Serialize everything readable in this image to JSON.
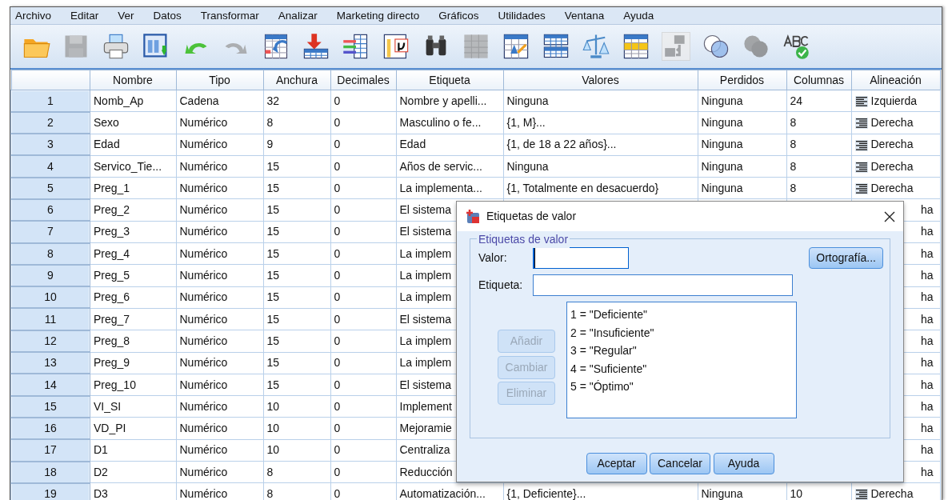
{
  "menu": [
    "Archivo",
    "Editar",
    "Ver",
    "Datos",
    "Transformar",
    "Analizar",
    "Marketing directo",
    "Gráficos",
    "Utilidades",
    "Ventana",
    "Ayuda"
  ],
  "toolbar": [
    {
      "kind": "open",
      "disabled": false
    },
    {
      "kind": "save",
      "disabled": true
    },
    {
      "kind": "print",
      "disabled": false
    },
    {
      "kind": "recall",
      "disabled": false
    },
    {
      "kind": "undo",
      "disabled": false
    },
    {
      "kind": "redo",
      "disabled": true
    },
    {
      "kind": "goto_case",
      "disabled": false
    },
    {
      "kind": "goto_var",
      "disabled": false
    },
    {
      "kind": "variables",
      "disabled": false
    },
    {
      "kind": "descriptives",
      "disabled": false
    },
    {
      "kind": "find",
      "disabled": false
    },
    {
      "kind": "insert_cases",
      "disabled": true
    },
    {
      "kind": "insert_var",
      "disabled": false
    },
    {
      "kind": "split",
      "disabled": false
    },
    {
      "kind": "weight",
      "disabled": false
    },
    {
      "kind": "select",
      "disabled": false
    },
    {
      "kind": "value_labels",
      "disabled": true
    },
    {
      "kind": "sets",
      "disabled": false
    },
    {
      "kind": "all_vars",
      "disabled": true
    },
    {
      "kind": "spell",
      "disabled": false
    }
  ],
  "table": {
    "columns": [
      "Nombre",
      "Tipo",
      "Anchura",
      "Decimales",
      "Etiqueta",
      "Valores",
      "Perdidos",
      "Columnas",
      "Alineación"
    ],
    "rows": [
      {
        "n": "1",
        "nombre": "Nomb_Ap",
        "tipo": "Cadena",
        "anchura": "32",
        "decimales": "0",
        "etiqueta": "Nombre y apelli...",
        "valores": "Ninguna",
        "perdidos": "Ninguna",
        "columnas": "24",
        "alineacion": {
          "text": "Izquierda",
          "kind": "align_left"
        }
      },
      {
        "n": "2",
        "nombre": "Sexo",
        "tipo": "Numérico",
        "anchura": "8",
        "decimales": "0",
        "etiqueta": "Masculino o fe...",
        "valores": "{1, M}...",
        "perdidos": "Ninguna",
        "columnas": "8",
        "alineacion": {
          "text": "Derecha",
          "kind": "align_right"
        }
      },
      {
        "n": "3",
        "nombre": "Edad",
        "tipo": "Numérico",
        "anchura": "9",
        "decimales": "0",
        "etiqueta": "Edad",
        "valores": "{1, de 18 a 22 años}...",
        "perdidos": "Ninguna",
        "columnas": "8",
        "alineacion": {
          "text": "Derecha",
          "kind": "align_right"
        }
      },
      {
        "n": "4",
        "nombre": "Servico_Tie...",
        "tipo": "Numérico",
        "anchura": "15",
        "decimales": "0",
        "etiqueta": "Años de servic...",
        "valores": "Ninguna",
        "perdidos": "Ninguna",
        "columnas": "8",
        "alineacion": {
          "text": "Derecha",
          "kind": "align_right"
        }
      },
      {
        "n": "5",
        "nombre": "Preg_1",
        "tipo": "Numérico",
        "anchura": "15",
        "decimales": "0",
        "etiqueta": "La implementa...",
        "valores": "{1, Totalmente en desacuerdo}",
        "perdidos": "Ninguna",
        "columnas": "8",
        "alineacion": {
          "text": "Derecha",
          "kind": "align_right"
        }
      },
      {
        "n": "6",
        "nombre": "Preg_2",
        "tipo": "Numérico",
        "anchura": "15",
        "decimales": "0",
        "etiqueta": "El sistema",
        "alineacion": {
          "text": "ha"
        }
      },
      {
        "n": "7",
        "nombre": "Preg_3",
        "tipo": "Numérico",
        "anchura": "15",
        "decimales": "0",
        "etiqueta": "El sistema",
        "alineacion": {
          "text": "ha"
        }
      },
      {
        "n": "8",
        "nombre": "Preg_4",
        "tipo": "Numérico",
        "anchura": "15",
        "decimales": "0",
        "etiqueta": "La implem",
        "alineacion": {
          "text": "ha"
        }
      },
      {
        "n": "9",
        "nombre": "Preg_5",
        "tipo": "Numérico",
        "anchura": "15",
        "decimales": "0",
        "etiqueta": "La implem",
        "alineacion": {
          "text": "ha"
        }
      },
      {
        "n": "10",
        "nombre": "Preg_6",
        "tipo": "Numérico",
        "anchura": "15",
        "decimales": "0",
        "etiqueta": "La implem",
        "alineacion": {
          "text": "ha"
        }
      },
      {
        "n": "11",
        "nombre": "Preg_7",
        "tipo": "Numérico",
        "anchura": "15",
        "decimales": "0",
        "etiqueta": "El sistema",
        "alineacion": {
          "text": "ha"
        }
      },
      {
        "n": "12",
        "nombre": "Preg_8",
        "tipo": "Numérico",
        "anchura": "15",
        "decimales": "0",
        "etiqueta": "La implem",
        "alineacion": {
          "text": "ha"
        }
      },
      {
        "n": "13",
        "nombre": "Preg_9",
        "tipo": "Numérico",
        "anchura": "15",
        "decimales": "0",
        "etiqueta": "La implem",
        "alineacion": {
          "text": "ha"
        }
      },
      {
        "n": "14",
        "nombre": "Preg_10",
        "tipo": "Numérico",
        "anchura": "15",
        "decimales": "0",
        "etiqueta": "El sistema",
        "alineacion": {
          "text": "ha"
        }
      },
      {
        "n": "15",
        "nombre": "VI_SI",
        "tipo": "Numérico",
        "anchura": "10",
        "decimales": "0",
        "etiqueta": "Implement",
        "alineacion": {
          "text": "ha"
        }
      },
      {
        "n": "16",
        "nombre": "VD_PI",
        "tipo": "Numérico",
        "anchura": "10",
        "decimales": "0",
        "etiqueta": "Mejoramie",
        "alineacion": {
          "text": "ha"
        }
      },
      {
        "n": "17",
        "nombre": "D1",
        "tipo": "Numérico",
        "anchura": "10",
        "decimales": "0",
        "etiqueta": "Centraliza",
        "alineacion": {
          "text": "ha"
        }
      },
      {
        "n": "18",
        "nombre": "D2",
        "tipo": "Numérico",
        "anchura": "8",
        "decimales": "0",
        "etiqueta": "Reducción",
        "alineacion": {
          "text": "ha"
        }
      },
      {
        "n": "19",
        "nombre": "D3",
        "tipo": "Numérico",
        "anchura": "8",
        "decimales": "0",
        "etiqueta": "Automatización...",
        "valores": "{1, Deficiente}...",
        "perdidos": "Ninguna",
        "columnas": "10",
        "alineacion": {
          "text": "Derecha",
          "kind": "align_right"
        }
      }
    ]
  },
  "dialog": {
    "title": "Etiquetas de valor",
    "group_title": "Etiquetas de valor",
    "valor": {
      "label": "Valor:",
      "focused": true
    },
    "etiqueta": {
      "label": "Etiqueta:"
    },
    "spell_button": "Ortografía...",
    "side_buttons": [
      {
        "label": "Añadir",
        "disabled": true
      },
      {
        "label": "Cambiar",
        "disabled": true
      },
      {
        "label": "Eliminar",
        "disabled": true
      }
    ],
    "labels": [
      {
        "text": "1 = \"Deficiente\"",
        "selected": false
      },
      {
        "text": "2 = \"Insuficiente\"",
        "selected": false
      },
      {
        "text": "3 = \"Regular\"",
        "selected": false
      },
      {
        "text": "4 = \"Suficiente\"",
        "selected": false
      },
      {
        "text": "5 = \"Óptimo\"",
        "selected": false
      }
    ],
    "buttons": [
      "Aceptar",
      "Cancelar",
      "Ayuda"
    ]
  }
}
